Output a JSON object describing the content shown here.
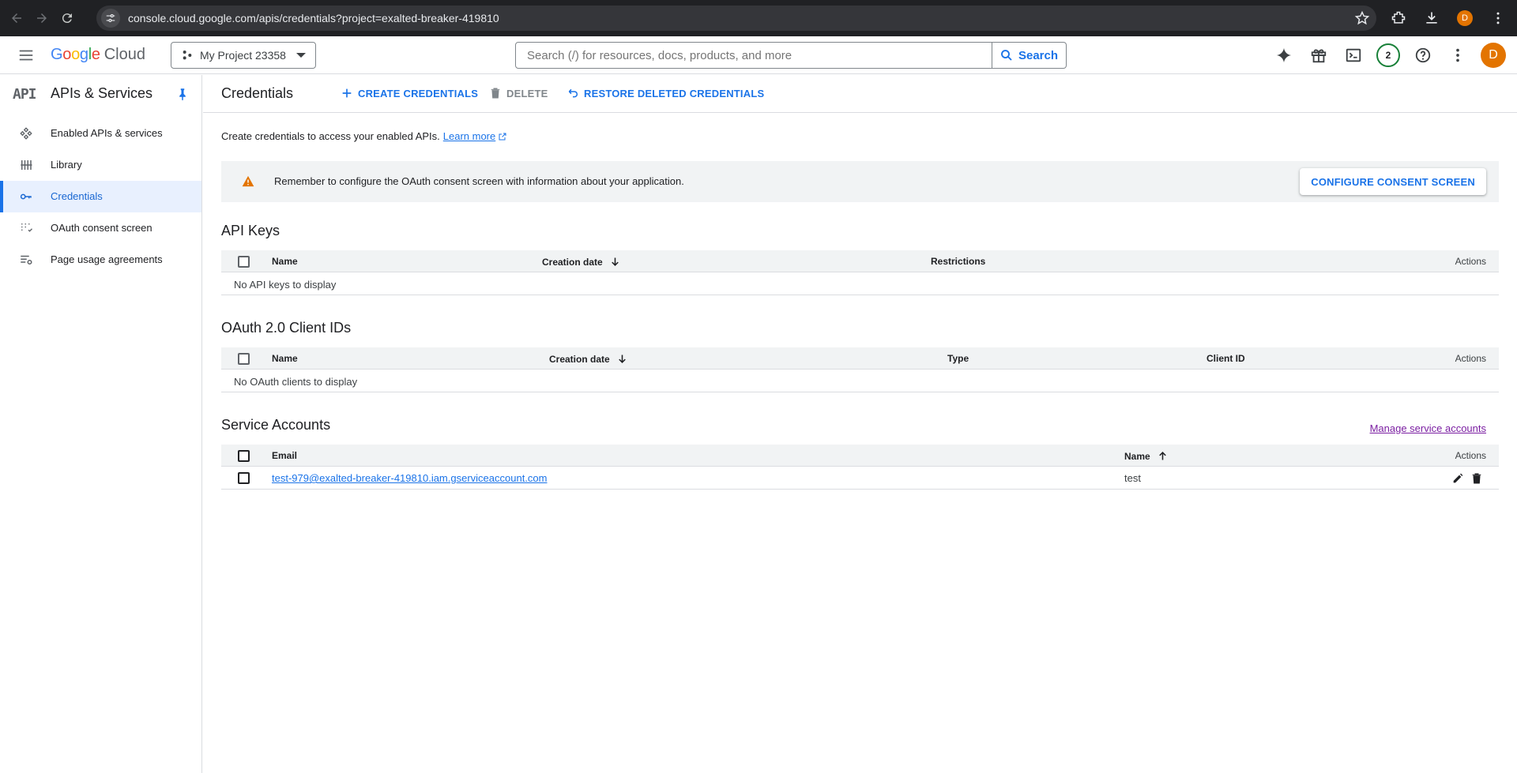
{
  "browser": {
    "url": "console.cloud.google.com/apis/credentials?project=exalted-breaker-419810",
    "profile_initial": "D"
  },
  "header": {
    "logo_google": "Google",
    "logo_cloud": "Cloud",
    "project": "My Project 23358",
    "search_placeholder": "Search (/) for resources, docs, products, and more",
    "search_button": "Search",
    "notification_count": "2",
    "user_initial": "D"
  },
  "sidebar": {
    "logo_text": "API",
    "title": "APIs & Services",
    "items": [
      {
        "label": "Enabled APIs & services",
        "icon": "enabled-apis-icon"
      },
      {
        "label": "Library",
        "icon": "library-icon"
      },
      {
        "label": "Credentials",
        "icon": "key-icon",
        "active": true
      },
      {
        "label": "OAuth consent screen",
        "icon": "consent-icon"
      },
      {
        "label": "Page usage agreements",
        "icon": "settings-list-icon"
      }
    ]
  },
  "toolbar": {
    "title": "Credentials",
    "create": "CREATE CREDENTIALS",
    "delete": "DELETE",
    "restore": "RESTORE DELETED CREDENTIALS"
  },
  "intro": {
    "text": "Create credentials to access your enabled APIs.",
    "learn_more": "Learn more"
  },
  "banner": {
    "message": "Remember to configure the OAuth consent screen with information about your application.",
    "button": "CONFIGURE CONSENT SCREEN"
  },
  "api_keys": {
    "title": "API Keys",
    "columns": [
      "Name",
      "Creation date",
      "Restrictions",
      "Actions"
    ],
    "empty": "No API keys to display"
  },
  "oauth": {
    "title": "OAuth 2.0 Client IDs",
    "columns": [
      "Name",
      "Creation date",
      "Type",
      "Client ID",
      "Actions"
    ],
    "empty": "No OAuth clients to display"
  },
  "service_accounts": {
    "title": "Service Accounts",
    "manage_link": "Manage service accounts",
    "columns": [
      "Email",
      "Name",
      "Actions"
    ],
    "rows": [
      {
        "email": "test-979@exalted-breaker-419810.iam.gserviceaccount.com",
        "name": "test"
      }
    ]
  },
  "colors": {
    "accent": "#1a73e8",
    "active_bg": "#e8f0fe",
    "warning": "#e37400",
    "avatar": "#e37400",
    "visited_link": "#7b1fa2"
  }
}
